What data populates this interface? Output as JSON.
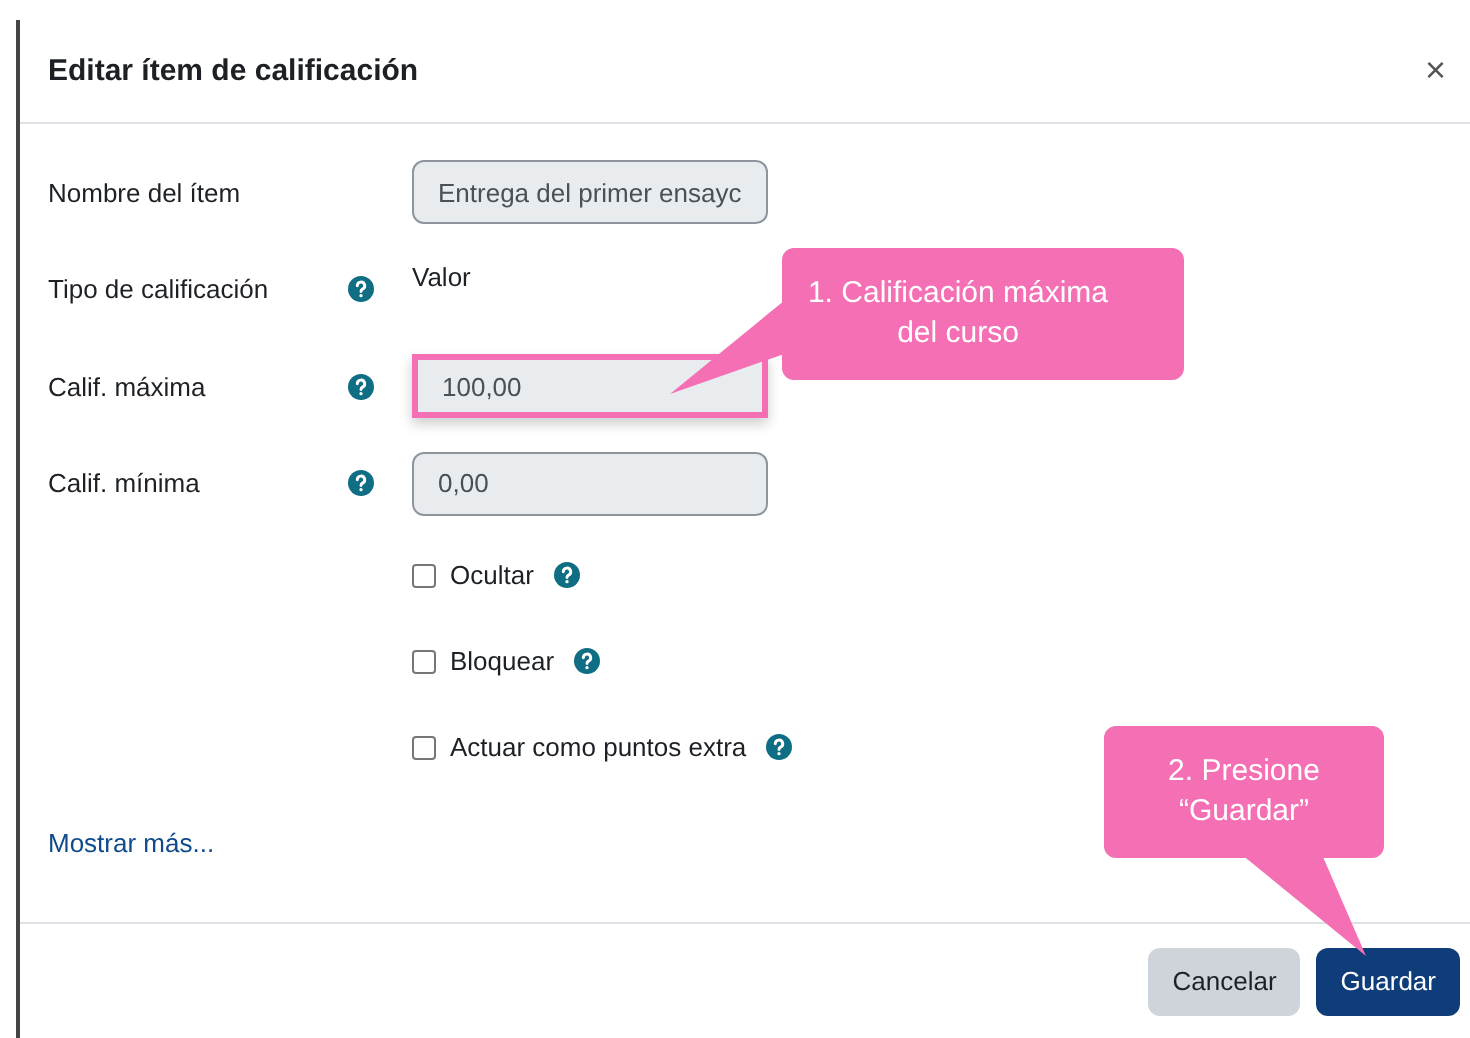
{
  "dialog": {
    "title": "Editar ítem de calificación",
    "close": "×"
  },
  "fields": [
    {
      "kind": "input",
      "label": "Nombre del ítem",
      "help": false,
      "value": "Entrega del primer ensayc",
      "highlighted": false
    },
    {
      "kind": "static",
      "label": "Tipo de calificación",
      "help": true,
      "value": "Valor",
      "highlighted": false
    },
    {
      "kind": "input",
      "label": "Calif. máxima",
      "help": true,
      "value": "100,00",
      "highlighted": true
    },
    {
      "kind": "input",
      "label": "Calif. mínima",
      "help": true,
      "value": "0,00",
      "highlighted": false
    }
  ],
  "checkboxes": [
    {
      "label": "Ocultar",
      "checked": false,
      "help": true
    },
    {
      "label": "Bloquear",
      "checked": false,
      "help": true
    },
    {
      "label": "Actuar como puntos extra",
      "checked": false,
      "help": true
    }
  ],
  "link": "Mostrar más...",
  "buttons": [
    {
      "label": "Cancelar",
      "kind": "secondary"
    },
    {
      "label": "Guardar",
      "kind": "primary"
    }
  ],
  "callouts": [
    {
      "text": "1. Calificación máxima del curso"
    },
    {
      "text": "2. Presione “Guardar”"
    }
  ]
}
